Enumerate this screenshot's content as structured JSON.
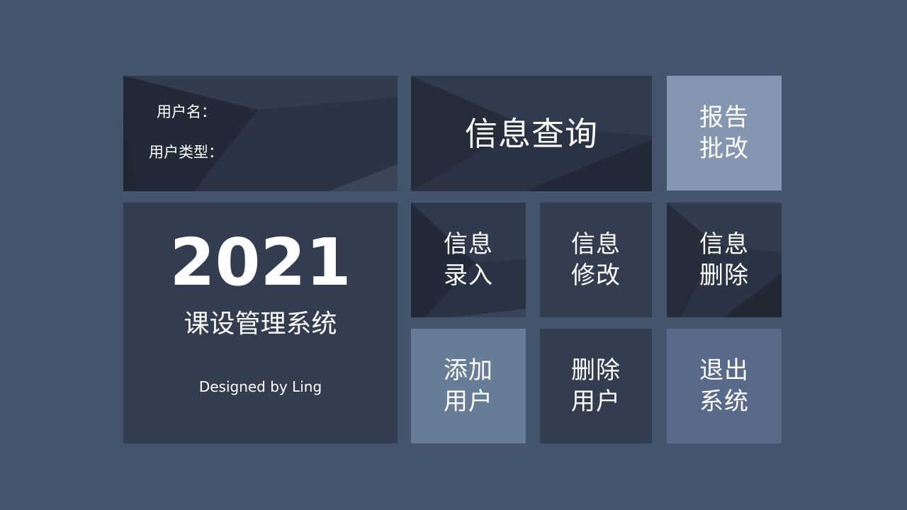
{
  "user_panel": {
    "username_label": "用户名：",
    "usertype_label": "用户类型："
  },
  "brand": {
    "year": "2021",
    "title": "课设管理系统",
    "designer": "Designed by Ling"
  },
  "tiles": {
    "query": "信息查询",
    "report": "报告\n批改",
    "entry": "信息\n录入",
    "modify": "信息\n修改",
    "delete": "信息\n删除",
    "add_user": "添加\n用户",
    "delete_user": "删除\n用户",
    "exit": "退出\n系统"
  },
  "colors": {
    "background": "#44546d",
    "dark_tile": "#2a3344",
    "mid_tile": "#333d50",
    "report_tile": "#8496b0",
    "add_user_tile": "#667c97",
    "exit_tile": "#58698a"
  }
}
